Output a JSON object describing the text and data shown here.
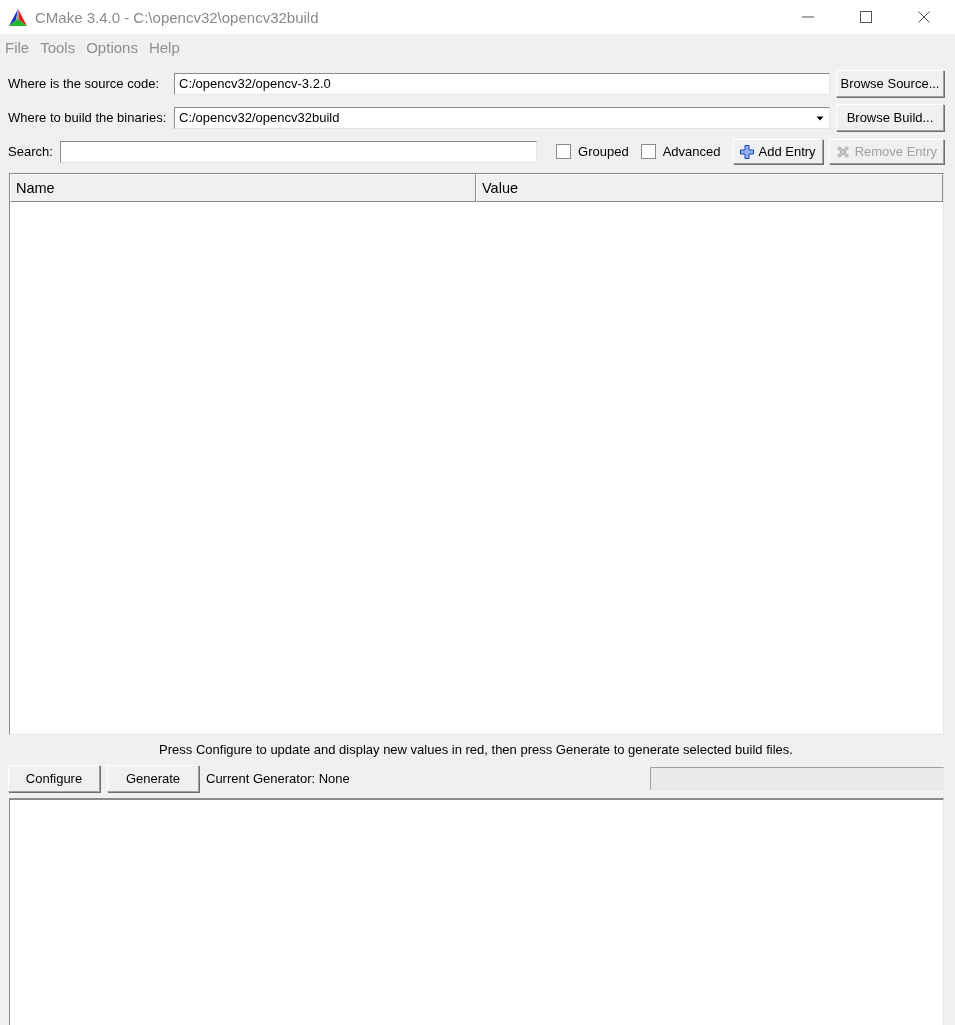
{
  "window": {
    "title": "CMake 3.4.0 - C:\\opencv32\\opencv32build"
  },
  "menu": [
    "File",
    "Tools",
    "Options",
    "Help"
  ],
  "source": {
    "label": "Where is the source code:",
    "value": "C:/opencv32/opencv-3.2.0",
    "button": "Browse Source..."
  },
  "build": {
    "label": "Where to build the binaries:",
    "value": "C:/opencv32/opencv32build",
    "button": "Browse Build..."
  },
  "search": {
    "label": "Search:"
  },
  "options": [
    {
      "label": "Grouped",
      "checked": false
    },
    {
      "label": "Advanced",
      "checked": false
    }
  ],
  "entry_buttons": [
    {
      "label": "Add Entry",
      "kind": "add",
      "disabled": false
    },
    {
      "label": "Remove Entry",
      "kind": "remove",
      "disabled": true
    }
  ],
  "table": {
    "columns": [
      "Name",
      "Value"
    ]
  },
  "message": "Press Configure to update and display new values in red, then press Generate to generate selected build files.",
  "actions": [
    "Configure",
    "Generate"
  ],
  "generator": "Current Generator: None",
  "progress": {
    "level": 0
  }
}
